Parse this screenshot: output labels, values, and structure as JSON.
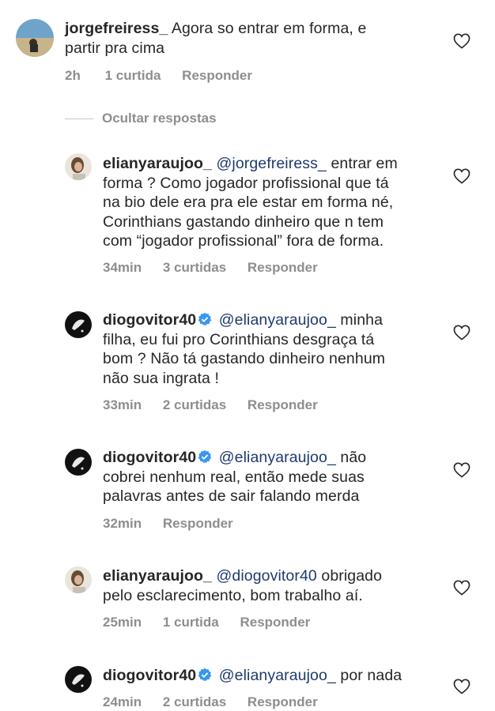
{
  "main_comment": {
    "username": "jorgefreiress_",
    "text_line1": "Agora so entrar em forma, e",
    "text_line2": "partir pra cima",
    "time": "2h",
    "likes": "1 curtida",
    "reply_label": "Responder"
  },
  "hide_replies_label": "Ocultar respostas",
  "replies": [
    {
      "username": "elianyaraujoo_",
      "mention": "@jorgefreiress_",
      "line1_rest": "entrar em",
      "lines": [
        "forma ? Como jogador profissional que tá",
        "na bio dele era pra ele estar em forma né,",
        "Corinthians gastando dinheiro que n tem",
        "com “jogador profissional” fora de forma."
      ],
      "time": "34min",
      "likes": "3 curtidas",
      "reply_label": "Responder"
    },
    {
      "username": "diogovitor40",
      "mention": "@elianyaraujoo_",
      "line1_rest": "minha",
      "lines": [
        "filha, eu fui pro Corinthians desgraça tá",
        "bom ? Não tá gastando dinheiro nenhum",
        "não sua ingrata !"
      ],
      "time": "33min",
      "likes": "2 curtidas",
      "reply_label": "Responder"
    },
    {
      "username": "diogovitor40",
      "mention": "@elianyaraujoo_",
      "line1_rest": "não",
      "lines": [
        "cobrei nenhum real, então mede suas",
        "palavras antes de sair falando merda"
      ],
      "time": "32min",
      "likes": "",
      "reply_label": "Responder"
    },
    {
      "username": "elianyaraujoo_",
      "mention": "@diogovitor40",
      "line1_rest": "obrigado",
      "lines": [
        "pelo esclarecimento, bom trabalho aí."
      ],
      "time": "25min",
      "likes": "1 curtida",
      "reply_label": "Responder"
    },
    {
      "username": "diogovitor40",
      "mention": "@elianyaraujoo_",
      "line1_rest": "por nada",
      "lines": [],
      "time": "24min",
      "likes": "2 curtidas",
      "reply_label": "Responder"
    }
  ],
  "icons": {
    "heart": "heart-outline-icon",
    "verified": "verified-badge-icon"
  },
  "colors": {
    "text": "#262626",
    "meta": "#8e8e8e",
    "mention": "#1e3a6e",
    "verified": "#3897f0"
  }
}
